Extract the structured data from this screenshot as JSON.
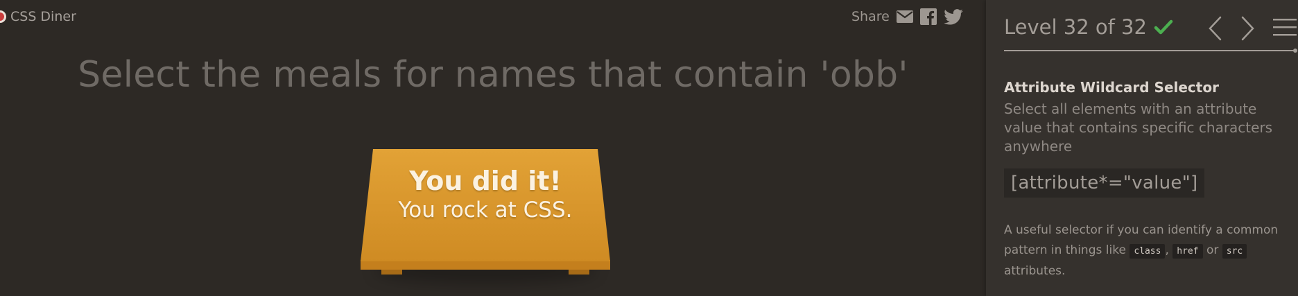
{
  "logo": {
    "label": "CSS Diner"
  },
  "share": {
    "label": "Share",
    "icons": [
      "email-icon",
      "facebook-icon",
      "twitter-icon"
    ]
  },
  "game": {
    "instruction": "Select the meals for names that contain 'obb'",
    "win_title": "You did it!",
    "win_subtitle": "You rock at CSS."
  },
  "sidebar": {
    "level_title": "Level 32 of 32",
    "level_completed": true,
    "progress_fraction": 1.0,
    "selector_name": "Attribute Wildcard Selector",
    "selector_description": "Select all elements with an attribute value that contains specific characters anywhere",
    "syntax": "[attribute*=\"value\"]",
    "hint": {
      "text_before": "A useful selector if you can identify a common pattern in things like",
      "code1": "class",
      "sep1": ",",
      "code2": "href",
      "sep2": "or",
      "code3": "src",
      "text_after": "attributes."
    }
  },
  "colors": {
    "background": "#2d2925",
    "sidebar": "#35312d",
    "table": "#e2a236",
    "check": "#4caf50",
    "logo_dot": "#c93c3c"
  }
}
